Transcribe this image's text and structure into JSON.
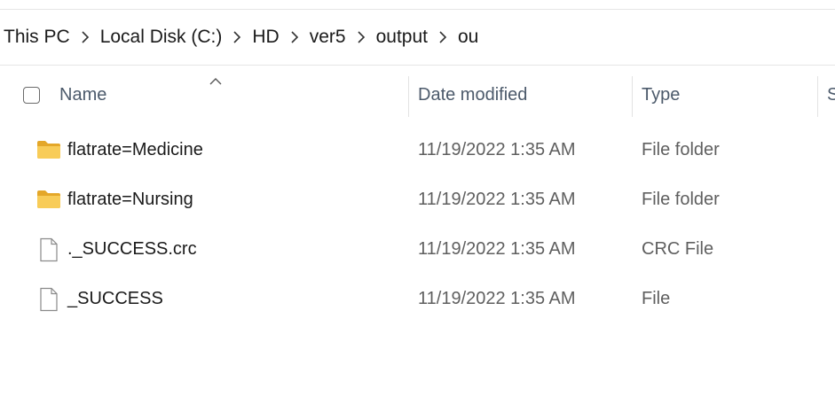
{
  "breadcrumb": {
    "items": [
      "This PC",
      "Local Disk (C:)",
      "HD",
      "ver5",
      "output",
      "ou"
    ],
    "separator_icon": "chevron-right-icon"
  },
  "columns": {
    "name": "Name",
    "date_modified": "Date modified",
    "type": "Type",
    "size_partial": "S"
  },
  "sort": {
    "column": "name",
    "direction": "ascending",
    "icon": "sort-up-icon"
  },
  "files": [
    {
      "name": "flatrate=Medicine",
      "date": "11/19/2022 1:35 AM",
      "type": "File folder",
      "icon": "folder-icon"
    },
    {
      "name": "flatrate=Nursing",
      "date": "11/19/2022 1:35 AM",
      "type": "File folder",
      "icon": "folder-icon"
    },
    {
      "name": "._SUCCESS.crc",
      "date": "11/19/2022 1:35 AM",
      "type": "CRC File",
      "icon": "file-icon"
    },
    {
      "name": "_SUCCESS",
      "date": "11/19/2022 1:35 AM",
      "type": "File",
      "icon": "file-icon"
    }
  ],
  "colors": {
    "folder": "#f5c242",
    "folder_dark": "#e4a729",
    "header_text": "#4c5a6b",
    "secondary_text": "#5f5f5f"
  }
}
